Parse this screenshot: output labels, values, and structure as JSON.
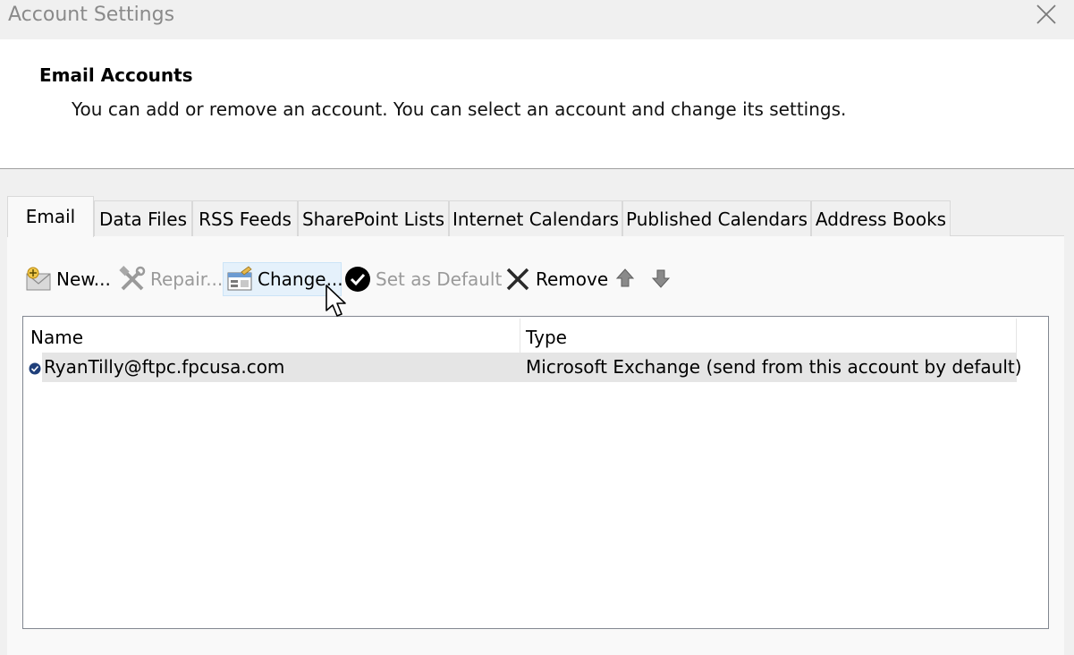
{
  "window": {
    "title": "Account Settings",
    "close_icon": "close-icon"
  },
  "header": {
    "title": "Email Accounts",
    "description": "You can add or remove an account. You can select an account and change its settings."
  },
  "tabs": [
    {
      "label": "Email",
      "active": true
    },
    {
      "label": "Data Files",
      "active": false
    },
    {
      "label": "RSS Feeds",
      "active": false
    },
    {
      "label": "SharePoint Lists",
      "active": false
    },
    {
      "label": "Internet Calendars",
      "active": false
    },
    {
      "label": "Published Calendars",
      "active": false
    },
    {
      "label": "Address Books",
      "active": false
    }
  ],
  "toolbar": {
    "new_label": "New...",
    "repair_label": "Repair...",
    "change_label": "Change...",
    "set_default_label": "Set as Default",
    "remove_label": "Remove",
    "icons": [
      "new-account-icon",
      "repair-icon",
      "change-icon",
      "set-default-icon",
      "remove-icon",
      "move-up-icon",
      "move-down-icon"
    ]
  },
  "account_list": {
    "columns": [
      "Name",
      "Type"
    ],
    "rows": [
      {
        "name": "RyanTilly@ftpc.fpcusa.com",
        "type": "Microsoft Exchange (send from this account by default)",
        "is_default": true,
        "selected": true
      }
    ]
  },
  "colors": {
    "window_bg": "#f0f0f0",
    "header_bg": "#ffffff",
    "selected_row": "#e5e5e5",
    "hover_button": "#e5f1fb",
    "disabled_text": "#9a9a9a"
  }
}
